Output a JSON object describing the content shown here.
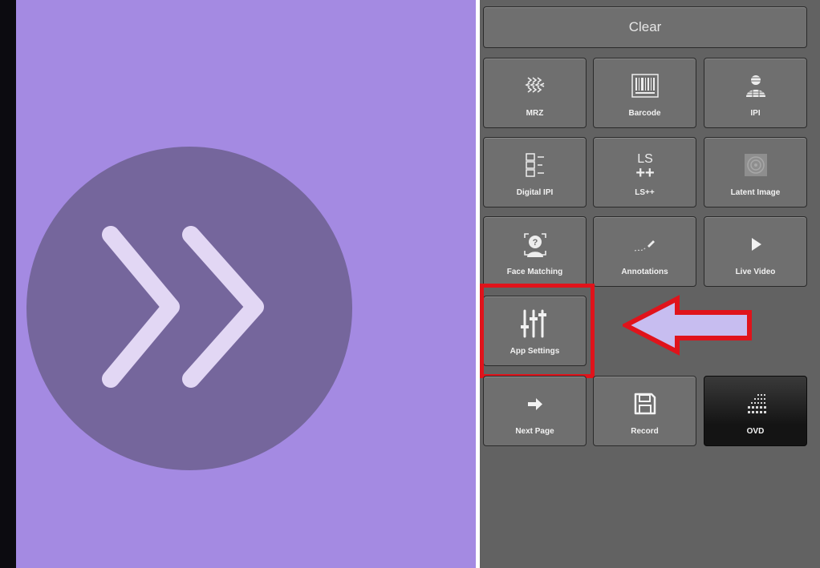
{
  "colors": {
    "left_background": "#a48ae2",
    "circle": "#75669c",
    "chevrons": "#e2d7f4",
    "panel_background": "#626262",
    "tile": "#6f6f6f",
    "highlight": "#e0131b",
    "arrow_fill": "#c7bdf0"
  },
  "left": {
    "button_icon": "double-chevron-right-icon"
  },
  "right": {
    "clear_label": "Clear",
    "tiles": [
      {
        "label": "MRZ",
        "icon": "mrz-icon"
      },
      {
        "label": "Barcode",
        "icon": "barcode-icon"
      },
      {
        "label": "IPI",
        "icon": "ipi-icon"
      },
      {
        "label": "Digital IPI",
        "icon": "digital-ipi-icon"
      },
      {
        "label": "LS++",
        "icon": "ls-plus-plus-icon"
      },
      {
        "label": "Latent Image",
        "icon": "latent-image-icon"
      },
      {
        "label": "Face Matching",
        "icon": "face-matching-icon"
      },
      {
        "label": "Annotations",
        "icon": "annotations-icon"
      },
      {
        "label": "Live Video",
        "icon": "play-icon"
      },
      {
        "label": "App Settings",
        "icon": "sliders-icon"
      },
      {
        "label": "Next Page",
        "icon": "arrow-right-icon"
      },
      {
        "label": "Record",
        "icon": "floppy-disk-icon"
      },
      {
        "label": "OVD",
        "icon": "ovd-dot-grid-icon"
      }
    ],
    "callout_icon": "arrow-left-callout-icon"
  }
}
